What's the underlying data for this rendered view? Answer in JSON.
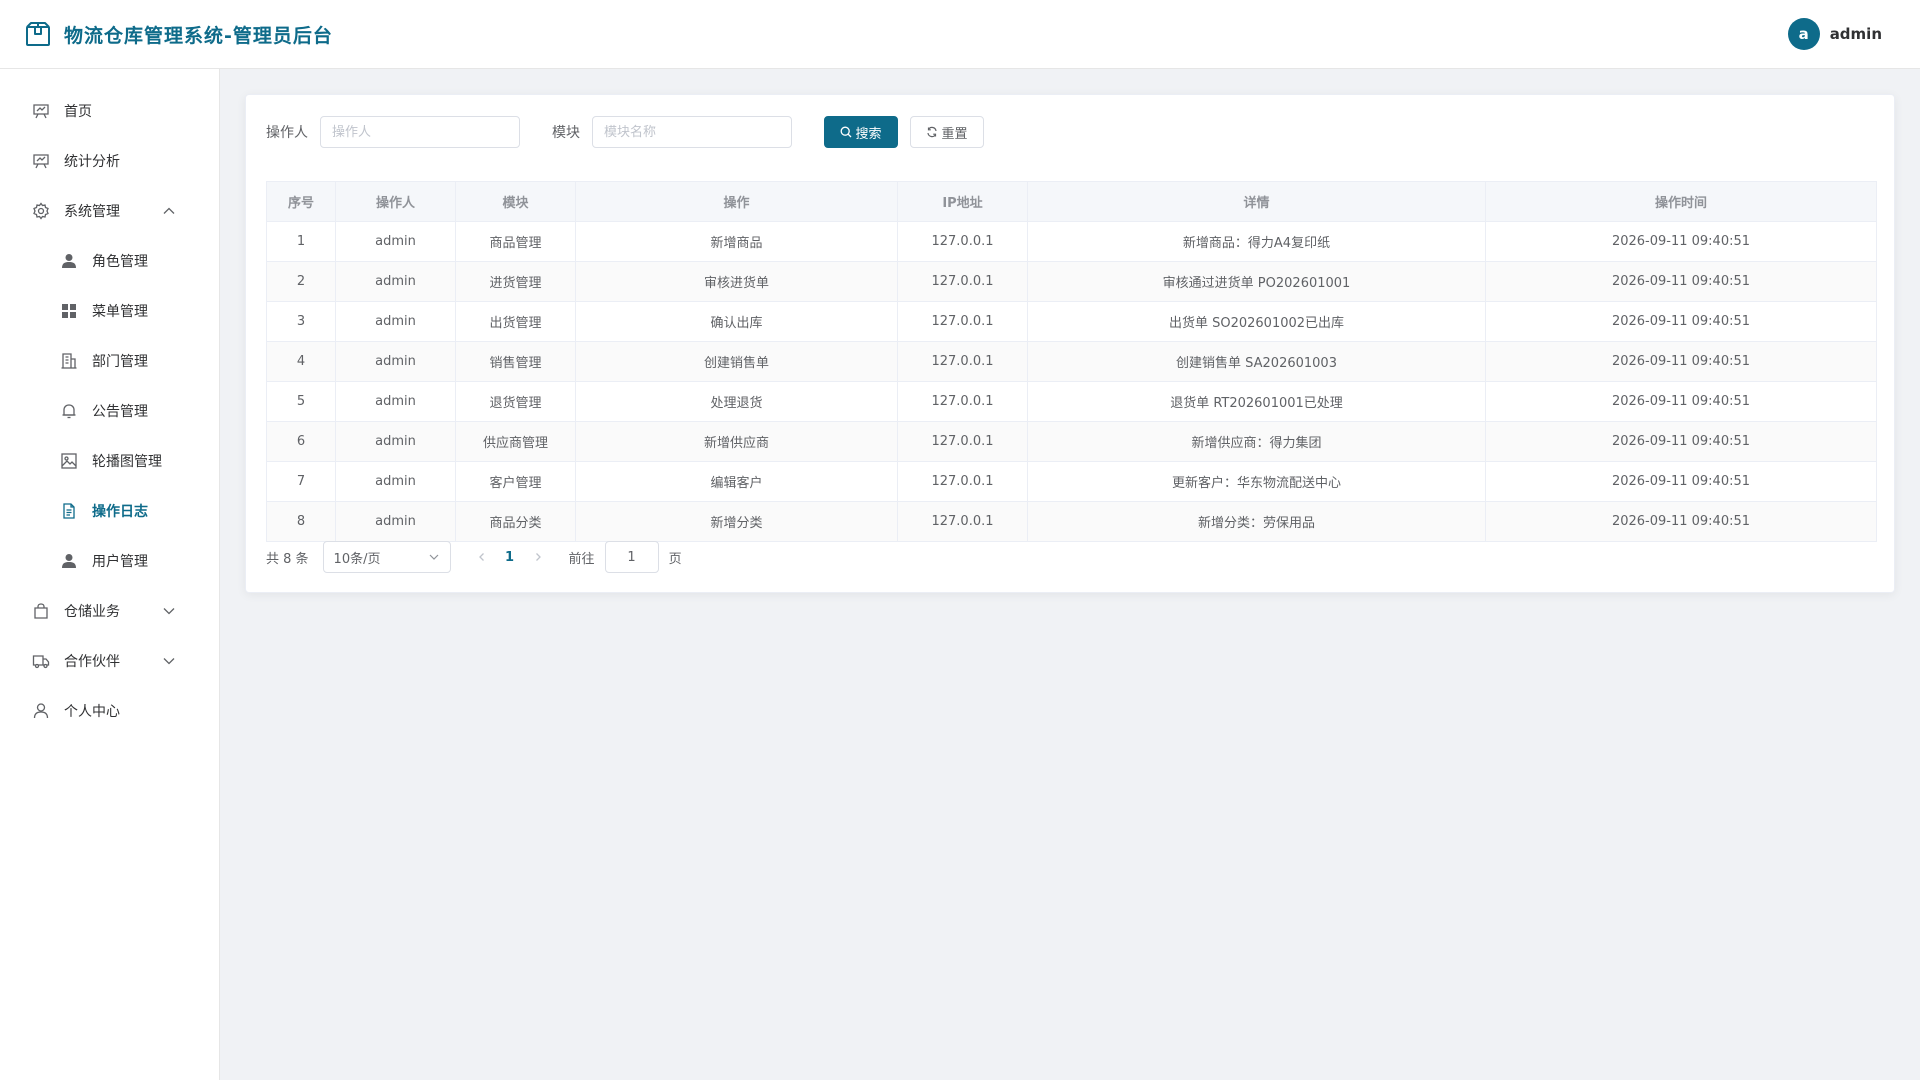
{
  "header": {
    "title": "物流仓库管理系统-管理员后台",
    "avatar_letter": "a",
    "username": "admin"
  },
  "sidebar": {
    "items": [
      {
        "label": "首页",
        "icon": "chart-board-icon"
      },
      {
        "label": "统计分析",
        "icon": "chart-board-icon"
      },
      {
        "label": "系统管理",
        "icon": "gear-icon",
        "expanded": true
      },
      {
        "label": "角色管理",
        "icon": "user-solid-icon"
      },
      {
        "label": "菜单管理",
        "icon": "grid-icon"
      },
      {
        "label": "部门管理",
        "icon": "building-icon"
      },
      {
        "label": "公告管理",
        "icon": "bell-icon"
      },
      {
        "label": "轮播图管理",
        "icon": "picture-icon"
      },
      {
        "label": "操作日志",
        "icon": "document-icon",
        "active": true
      },
      {
        "label": "用户管理",
        "icon": "user-solid-icon"
      },
      {
        "label": "仓储业务",
        "icon": "shopping-bag-icon",
        "expanded": false
      },
      {
        "label": "合作伙伴",
        "icon": "truck-icon",
        "expanded": false
      },
      {
        "label": "个人中心",
        "icon": "user-outline-icon"
      }
    ]
  },
  "search": {
    "operator_label": "操作人",
    "operator_placeholder": "操作人",
    "module_label": "模块",
    "module_placeholder": "模块名称",
    "search_button": "搜索",
    "reset_button": "重置"
  },
  "table": {
    "columns": [
      "序号",
      "操作人",
      "模块",
      "操作",
      "IP地址",
      "详情",
      "操作时间"
    ],
    "rows": [
      [
        "1",
        "admin",
        "商品管理",
        "新增商品",
        "127.0.0.1",
        "新增商品：得力A4复印纸",
        "2026-09-11 09:40:51"
      ],
      [
        "2",
        "admin",
        "进货管理",
        "审核进货单",
        "127.0.0.1",
        "审核通过进货单 PO202601001",
        "2026-09-11 09:40:51"
      ],
      [
        "3",
        "admin",
        "出货管理",
        "确认出库",
        "127.0.0.1",
        "出货单 SO202601002已出库",
        "2026-09-11 09:40:51"
      ],
      [
        "4",
        "admin",
        "销售管理",
        "创建销售单",
        "127.0.0.1",
        "创建销售单 SA202601003",
        "2026-09-11 09:40:51"
      ],
      [
        "5",
        "admin",
        "退货管理",
        "处理退货",
        "127.0.0.1",
        "退货单 RT202601001已处理",
        "2026-09-11 09:40:51"
      ],
      [
        "6",
        "admin",
        "供应商管理",
        "新增供应商",
        "127.0.0.1",
        "新增供应商：得力集团",
        "2026-09-11 09:40:51"
      ],
      [
        "7",
        "admin",
        "客户管理",
        "编辑客户",
        "127.0.0.1",
        "更新客户：华东物流配送中心",
        "2026-09-11 09:40:51"
      ],
      [
        "8",
        "admin",
        "商品分类",
        "新增分类",
        "127.0.0.1",
        "新增分类：劳保用品",
        "2026-09-11 09:40:51"
      ]
    ]
  },
  "pagination": {
    "total_text": "共 8 条",
    "page_size": "10条/页",
    "current_page": "1",
    "goto_label": "前往",
    "goto_value": "1",
    "page_suffix": "页"
  },
  "colors": {
    "primary": "#0e6b8a",
    "background": "#f0f2f5"
  }
}
